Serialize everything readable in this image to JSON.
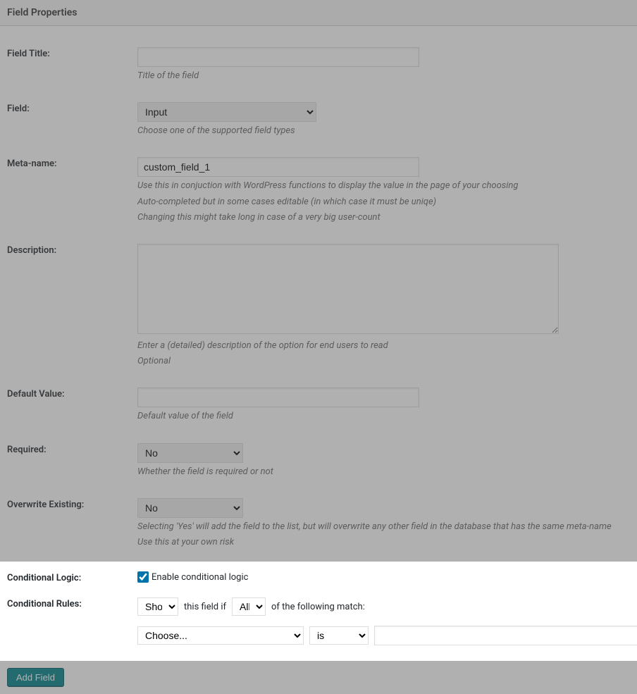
{
  "header": {
    "title": "Field Properties"
  },
  "fields": {
    "title": {
      "label": "Field Title:",
      "value": "",
      "help": "Title of the field"
    },
    "fieldtype": {
      "label": "Field:",
      "selected": "Input",
      "help": "Choose one of the supported field types"
    },
    "metaname": {
      "label": "Meta-name:",
      "value": "custom_field_1",
      "help1": "Use this in conjuction with WordPress functions to display the value in the page of your choosing",
      "help2": "Auto-completed but in some cases editable (in which case it must be uniqe)",
      "help3": "Changing this might take long in case of a very big user-count"
    },
    "description": {
      "label": "Description:",
      "value": "",
      "help1": "Enter a (detailed) description of the option for end users to read",
      "help2": "Optional"
    },
    "defaultv": {
      "label": "Default Value:",
      "value": "",
      "help": "Default value of the field"
    },
    "required": {
      "label": "Required:",
      "selected": "No",
      "help": "Whether the field is required or not"
    },
    "overwrite": {
      "label": "Overwrite Existing:",
      "selected": "No",
      "help1": "Selecting 'Yes' will add the field to the list, but will overwrite any other field in the database that has the same meta-name",
      "help2": "Use this at your own risk"
    }
  },
  "conditional": {
    "logic_label": "Conditional Logic:",
    "enable_label": "Enable conditional logic",
    "enable_checked": true,
    "rules_label": "Conditional Rules:",
    "action": "Show",
    "text_middle1": "this field if",
    "scope": "All",
    "text_middle2": "of the following match:",
    "rule_field": "Choose...",
    "rule_op": "is",
    "rule_value": ""
  },
  "footer": {
    "add_button": "Add Field"
  }
}
